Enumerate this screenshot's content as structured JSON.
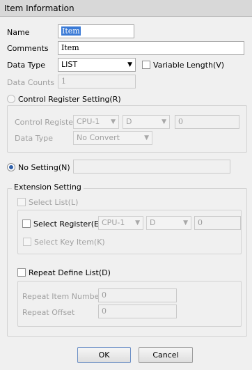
{
  "window": {
    "title": "Item Information"
  },
  "name": {
    "label": "Name",
    "value": "Item"
  },
  "comments": {
    "label": "Comments",
    "value": "Item"
  },
  "data_type": {
    "label": "Data Type",
    "value": "LIST"
  },
  "variable_length": {
    "label": "Variable Length(V)",
    "checked": false
  },
  "data_counts": {
    "label": "Data Counts",
    "value": "1"
  },
  "control_register_setting": {
    "label": "Control Register Setting(R)",
    "selected": false,
    "control_register_label": "Control Register",
    "cpu": "CPU-1",
    "device": "D",
    "address": "0",
    "data_type_label": "Data Type",
    "data_type_value": "No Convert"
  },
  "no_setting": {
    "label": "No Setting(N)",
    "selected": true,
    "value": ""
  },
  "extension_setting": {
    "label": "Extension Setting",
    "select_list": {
      "label": "Select List(L)",
      "checked": false
    },
    "select_register": {
      "label": "Select Register(E)",
      "checked": false,
      "cpu": "CPU-1",
      "device": "D",
      "address": "0"
    },
    "select_key_item": {
      "label": "Select Key Item(K)",
      "checked": false
    },
    "repeat_define_list": {
      "label": "Repeat Define List(D)",
      "checked": false,
      "repeat_item_number_label": "Repeat Item Number",
      "repeat_item_number": "0",
      "repeat_offset_label": "Repeat Offset",
      "repeat_offset": "0"
    }
  },
  "buttons": {
    "ok": "OK",
    "cancel": "Cancel"
  }
}
